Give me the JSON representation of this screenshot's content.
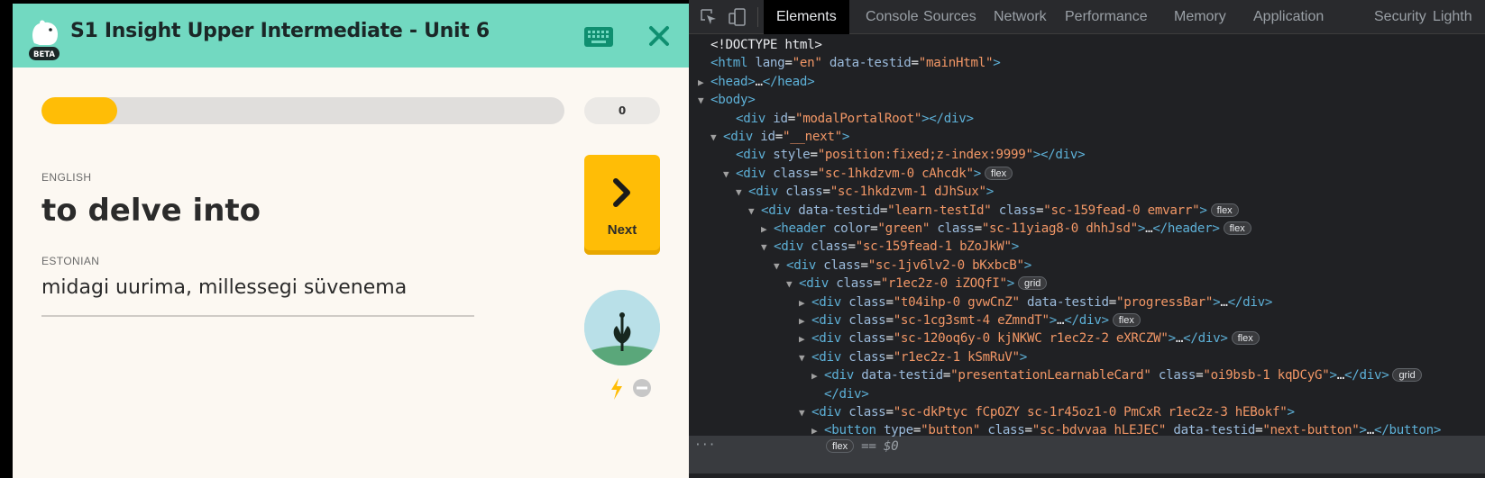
{
  "app": {
    "title": "S1 Insight Upper Intermediate - Unit 6",
    "beta_badge": "BETA",
    "progress_fraction": 0.145,
    "score": "0",
    "source_language": "ENGLISH",
    "source_word": "to delve into",
    "target_language": "ESTONIAN",
    "target_word": "midagi uurima, millessegi süvenema",
    "next_label": "Next",
    "colors": {
      "header": "#72d9c1",
      "accent": "#ffbd06",
      "background": "#fcf8f2",
      "close": "#0f8f70"
    }
  },
  "devtools": {
    "tabs": [
      "Elements",
      "Console",
      "Sources",
      "Network",
      "Performance",
      "Memory",
      "Application",
      "Security",
      "Lighth"
    ],
    "active_tab": "Elements",
    "dom_lines": [
      {
        "tri": "",
        "segs": [
          [
            "p",
            "<!DOCTYPE html>"
          ]
        ]
      },
      {
        "tri": "",
        "segs": [
          [
            "t",
            "<html "
          ],
          [
            "a",
            "lang"
          ],
          [
            "p",
            "="
          ],
          [
            "v",
            "\"en\""
          ],
          [
            "a",
            " data-testid"
          ],
          [
            "p",
            "="
          ],
          [
            "v",
            "\"mainHtml\""
          ],
          [
            "t",
            ">"
          ]
        ]
      },
      {
        "tri": "▶",
        "segs": [
          [
            "t",
            "<head>"
          ],
          [
            "p",
            "…"
          ],
          [
            "t",
            "</head>"
          ]
        ]
      },
      {
        "tri": "▼",
        "segs": [
          [
            "t",
            "<body>"
          ]
        ]
      },
      {
        "tri": "",
        "segs": [
          [
            "t",
            "<div "
          ],
          [
            "a",
            "id"
          ],
          [
            "p",
            "="
          ],
          [
            "v",
            "\"modalPortalRoot\""
          ],
          [
            "t",
            "></div>"
          ]
        ]
      },
      {
        "tri": "▼",
        "segs": [
          [
            "t",
            "<div "
          ],
          [
            "a",
            "id"
          ],
          [
            "p",
            "="
          ],
          [
            "v",
            "\"__next\""
          ],
          [
            "t",
            ">"
          ]
        ]
      },
      {
        "tri": "",
        "segs": [
          [
            "t",
            "<div "
          ],
          [
            "a",
            "style"
          ],
          [
            "p",
            "="
          ],
          [
            "v",
            "\"position:fixed;z-index:9999\""
          ],
          [
            "t",
            "></div>"
          ]
        ]
      },
      {
        "tri": "▼",
        "segs": [
          [
            "t",
            "<div "
          ],
          [
            "a",
            "class"
          ],
          [
            "p",
            "="
          ],
          [
            "v",
            "\"sc-1hkdzvm-0 cAhcdk\""
          ],
          [
            "t",
            ">"
          ]
        ],
        "badge": "flex"
      },
      {
        "tri": "▼",
        "segs": [
          [
            "t",
            "<div "
          ],
          [
            "a",
            "class"
          ],
          [
            "p",
            "="
          ],
          [
            "v",
            "\"sc-1hkdzvm-1 dJhSux\""
          ],
          [
            "t",
            ">"
          ]
        ]
      },
      {
        "tri": "▼",
        "segs": [
          [
            "t",
            "<div "
          ],
          [
            "a",
            "data-testid"
          ],
          [
            "p",
            "="
          ],
          [
            "v",
            "\"learn-testId\""
          ],
          [
            "a",
            " class"
          ],
          [
            "p",
            "="
          ],
          [
            "v",
            "\"sc-159fead-0 emvarr\""
          ],
          [
            "t",
            ">"
          ]
        ],
        "badge": "flex"
      },
      {
        "tri": "▶",
        "segs": [
          [
            "t",
            "<header "
          ],
          [
            "a",
            "color"
          ],
          [
            "p",
            "="
          ],
          [
            "v",
            "\"green\""
          ],
          [
            "a",
            " class"
          ],
          [
            "p",
            "="
          ],
          [
            "v",
            "\"sc-11yiag8-0 dhhJsd\""
          ],
          [
            "t",
            ">"
          ],
          [
            "p",
            "…"
          ],
          [
            "t",
            "</header>"
          ]
        ],
        "badge": "flex"
      },
      {
        "tri": "▼",
        "segs": [
          [
            "t",
            "<div "
          ],
          [
            "a",
            "class"
          ],
          [
            "p",
            "="
          ],
          [
            "v",
            "\"sc-159fead-1 bZoJkW\""
          ],
          [
            "t",
            ">"
          ]
        ]
      },
      {
        "tri": "▼",
        "segs": [
          [
            "t",
            "<div "
          ],
          [
            "a",
            "class"
          ],
          [
            "p",
            "="
          ],
          [
            "v",
            "\"sc-1jv6lv2-0 bKxbcB\""
          ],
          [
            "t",
            ">"
          ]
        ]
      },
      {
        "tri": "▼",
        "segs": [
          [
            "t",
            "<div "
          ],
          [
            "a",
            "class"
          ],
          [
            "p",
            "="
          ],
          [
            "v",
            "\"r1ec2z-0 iZOQfI\""
          ],
          [
            "t",
            ">"
          ]
        ],
        "badge": "grid"
      },
      {
        "tri": "▶",
        "segs": [
          [
            "t",
            "<div "
          ],
          [
            "a",
            "class"
          ],
          [
            "p",
            "="
          ],
          [
            "v",
            "\"t04ihp-0 gvwCnZ\""
          ],
          [
            "a",
            " data-testid"
          ],
          [
            "p",
            "="
          ],
          [
            "v",
            "\"progressBar\""
          ],
          [
            "t",
            ">"
          ],
          [
            "p",
            "…"
          ],
          [
            "t",
            "</div>"
          ]
        ]
      },
      {
        "tri": "▶",
        "segs": [
          [
            "t",
            "<div "
          ],
          [
            "a",
            "class"
          ],
          [
            "p",
            "="
          ],
          [
            "v",
            "\"sc-1cg3smt-4 eZmndT\""
          ],
          [
            "t",
            ">"
          ],
          [
            "p",
            "…"
          ],
          [
            "t",
            "</div>"
          ]
        ],
        "badge": "flex"
      },
      {
        "tri": "▶",
        "segs": [
          [
            "t",
            "<div "
          ],
          [
            "a",
            "class"
          ],
          [
            "p",
            "="
          ],
          [
            "v",
            "\"sc-120oq6y-0 kjNKWC r1ec2z-2 eXRCZW\""
          ],
          [
            "t",
            ">"
          ],
          [
            "p",
            "…"
          ],
          [
            "t",
            "</div>"
          ]
        ],
        "badge": "flex"
      },
      {
        "tri": "▼",
        "segs": [
          [
            "t",
            "<div "
          ],
          [
            "a",
            "class"
          ],
          [
            "p",
            "="
          ],
          [
            "v",
            "\"r1ec2z-1 kSmRuV\""
          ],
          [
            "t",
            ">"
          ]
        ]
      },
      {
        "tri": "▶",
        "segs": [
          [
            "t",
            "<div "
          ],
          [
            "a",
            "data-testid"
          ],
          [
            "p",
            "="
          ],
          [
            "v",
            "\"presentationLearnableCard\""
          ],
          [
            "a",
            " class"
          ],
          [
            "p",
            "="
          ],
          [
            "v",
            "\"oi9bsb-1 kqDCyG\""
          ],
          [
            "t",
            ">"
          ],
          [
            "p",
            "…"
          ],
          [
            "t",
            "</div>"
          ]
        ],
        "badge": "grid"
      },
      {
        "tri": "",
        "segs": [
          [
            "t",
            "</div>"
          ]
        ]
      },
      {
        "tri": "▼",
        "segs": [
          [
            "t",
            "<div "
          ],
          [
            "a",
            "class"
          ],
          [
            "p",
            "="
          ],
          [
            "v",
            "\"sc-dkPtyc fCpOZY sc-1r45oz1-0 PmCxR r1ec2z-3 hEBokf\""
          ],
          [
            "t",
            ">"
          ]
        ]
      },
      {
        "tri": "▶",
        "segs": [
          [
            "t",
            "<button "
          ],
          [
            "a",
            "type"
          ],
          [
            "p",
            "="
          ],
          [
            "v",
            "\"button\""
          ],
          [
            "a",
            " class"
          ],
          [
            "p",
            "="
          ],
          [
            "v",
            "\"sc-bdvvaa hLEJEC\""
          ],
          [
            "a",
            " data-testid"
          ],
          [
            "p",
            "="
          ],
          [
            "v",
            "\"next-button\""
          ],
          [
            "t",
            ">"
          ],
          [
            "p",
            "…"
          ],
          [
            "t",
            "</button>"
          ]
        ]
      }
    ],
    "selected_badge": "flex",
    "selected_marker": "== $0",
    "ellipsis": "···"
  }
}
